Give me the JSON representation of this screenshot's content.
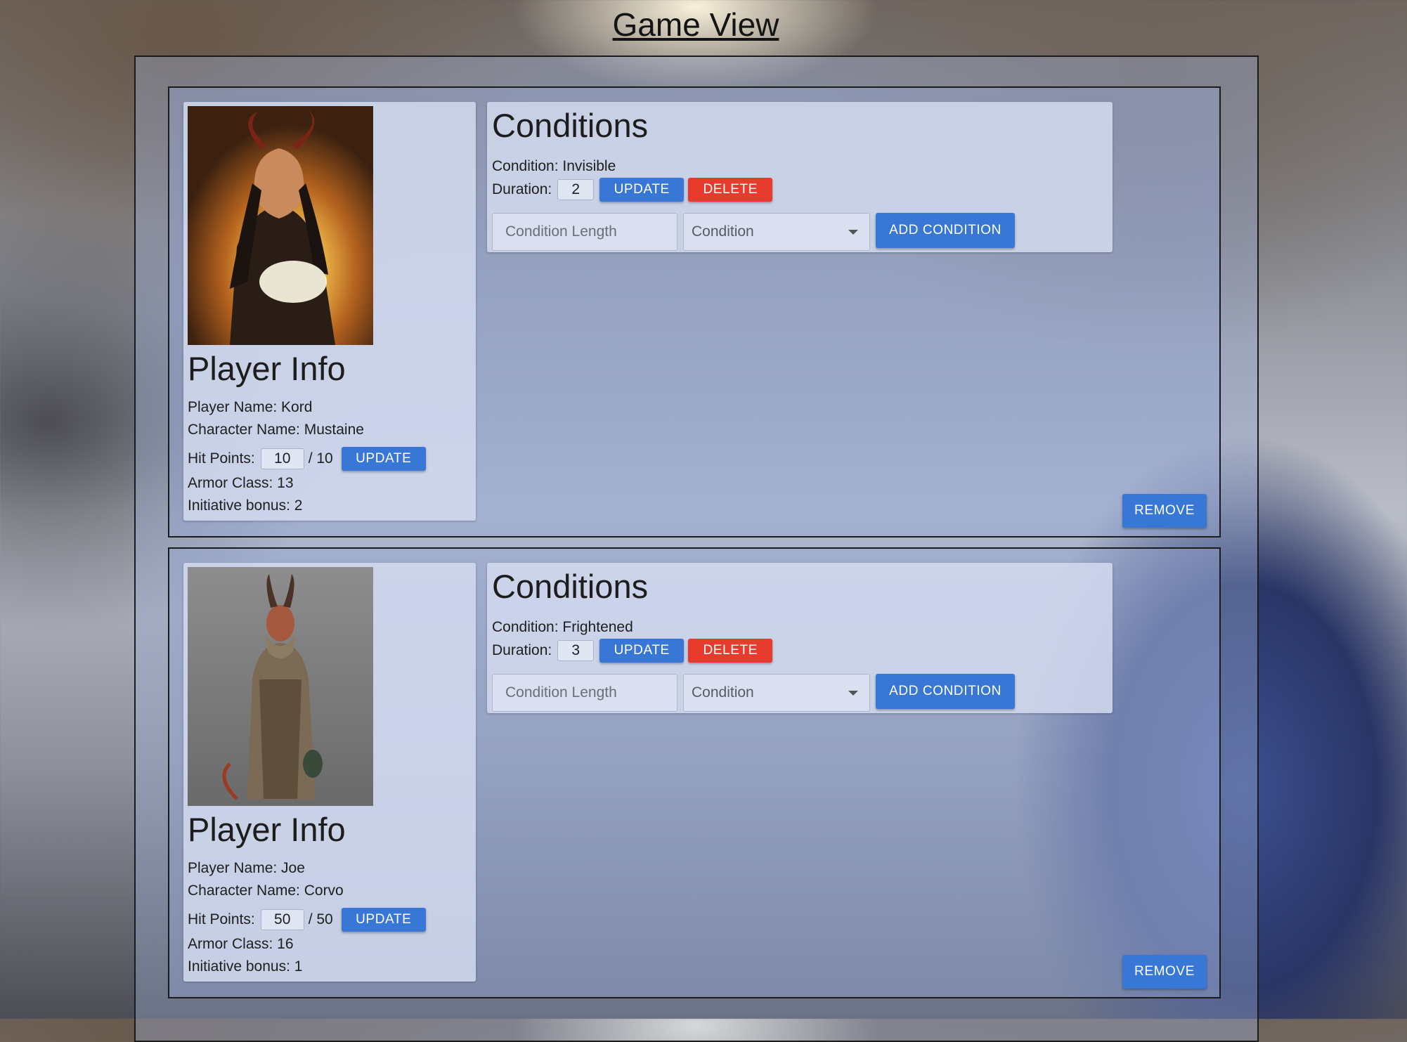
{
  "page": {
    "title": "Game View"
  },
  "players": [
    {
      "portrait_icon": "horned-sorcerer-portrait",
      "info_title": "Player Info",
      "player_name": "Player Name: Kord",
      "character_name": "Character Name: Mustaine",
      "hit_points_label": "Hit Points:",
      "hit_points_value": "10",
      "hit_points_max": "/ 10",
      "update_label": "UPDATE",
      "armor_class": "Armor Class: 13",
      "initiative": "Initiative bonus: 2",
      "conditions_title": "Conditions",
      "condition": "Condition: Invisible",
      "duration_label": "Duration:",
      "duration_value": "2",
      "duration_update_label": "UPDATE",
      "delete_label": "DELETE",
      "condition_length_placeholder": "Condition Length",
      "condition_select_label": "Condition",
      "add_condition_label": "ADD CONDITION",
      "remove_label": "REMOVE"
    },
    {
      "portrait_icon": "horned-monk-portrait",
      "info_title": "Player Info",
      "player_name": "Player Name: Joe",
      "character_name": "Character Name: Corvo",
      "hit_points_label": "Hit Points:",
      "hit_points_value": "50",
      "hit_points_max": "/ 50",
      "update_label": "UPDATE",
      "armor_class": "Armor Class: 16",
      "initiative": "Initiative bonus: 1",
      "conditions_title": "Conditions",
      "condition": "Condition: Frightened",
      "duration_label": "Duration:",
      "duration_value": "3",
      "duration_update_label": "UPDATE",
      "delete_label": "DELETE",
      "condition_length_placeholder": "Condition Length",
      "condition_select_label": "Condition",
      "add_condition_label": "ADD CONDITION",
      "remove_label": "REMOVE"
    }
  ]
}
